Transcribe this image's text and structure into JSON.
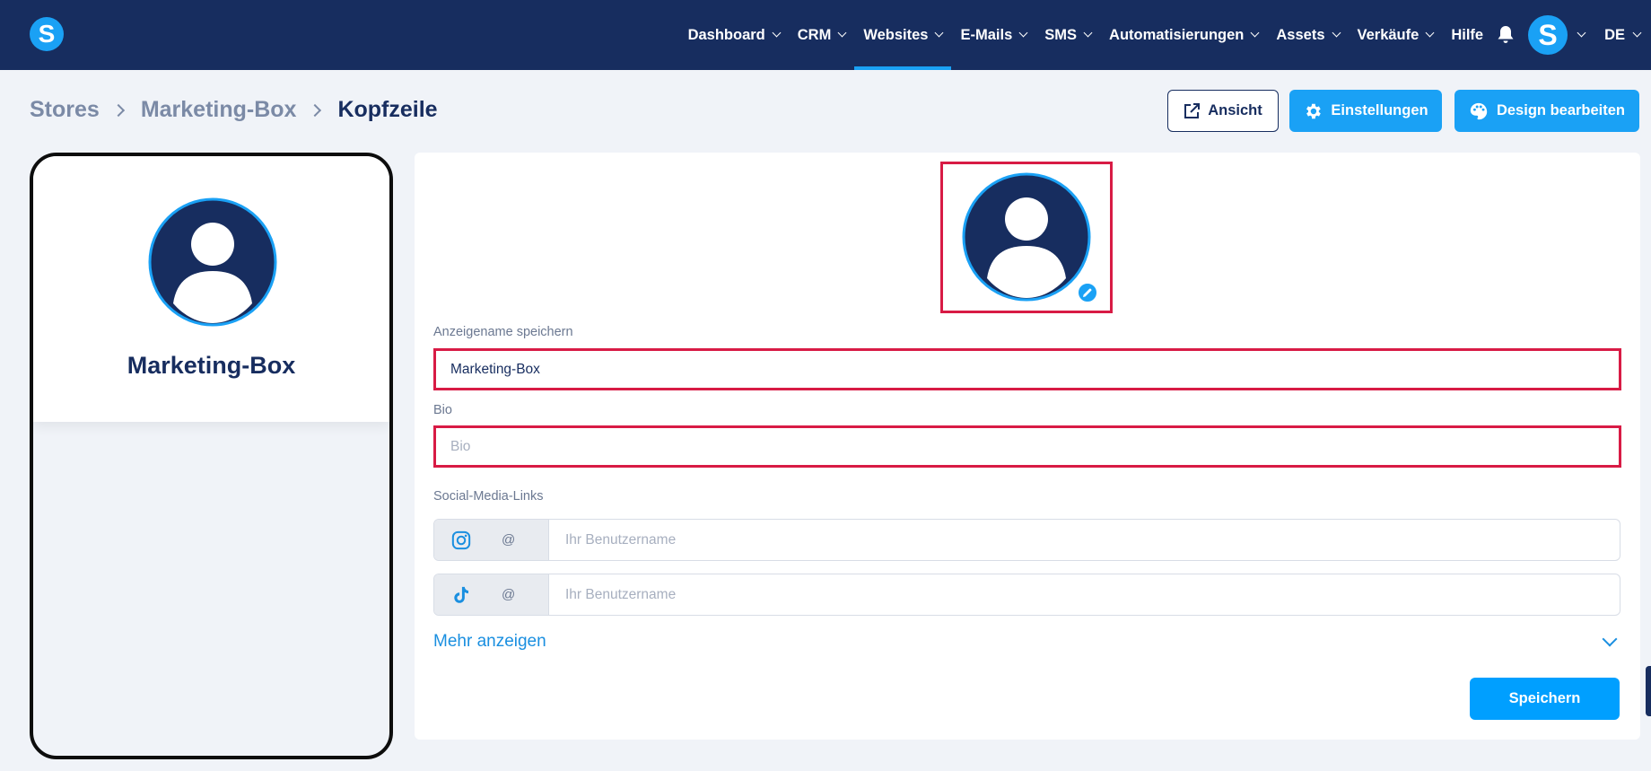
{
  "nav": {
    "logo": "S",
    "items": [
      {
        "label": "Dashboard",
        "active": false
      },
      {
        "label": "CRM",
        "active": false
      },
      {
        "label": "Websites",
        "active": true
      },
      {
        "label": "E-Mails",
        "active": false
      },
      {
        "label": "SMS",
        "active": false
      },
      {
        "label": "Automatisierungen",
        "active": false
      },
      {
        "label": "Assets",
        "active": false
      },
      {
        "label": "Verkäufe",
        "active": false
      }
    ],
    "help": "Hilfe",
    "bell_icon": "bell-icon",
    "avatar_letter": "S",
    "language": "DE"
  },
  "breadcrumb": [
    "Stores",
    "Marketing-Box",
    "Kopfzeile"
  ],
  "actions": {
    "view": "Ansicht",
    "settings": "Einstellungen",
    "design": "Design bearbeiten"
  },
  "preview": {
    "name": "Marketing-Box"
  },
  "form": {
    "display_name_label": "Anzeigename speichern",
    "display_name_value": "Marketing-Box",
    "bio_label": "Bio",
    "bio_placeholder": "Bio",
    "social_label": "Social-Media-Links",
    "social": [
      {
        "icon": "instagram-icon",
        "prefix": "@",
        "placeholder": "Ihr Benutzername"
      },
      {
        "icon": "tiktok-icon",
        "prefix": "@",
        "placeholder": "Ihr Benutzername"
      }
    ],
    "show_more": "Mehr anzeigen",
    "save": "Speichern"
  },
  "colors": {
    "navbar": "#172d5f",
    "accent": "#1aa1f5",
    "highlight": "#d81b45"
  }
}
